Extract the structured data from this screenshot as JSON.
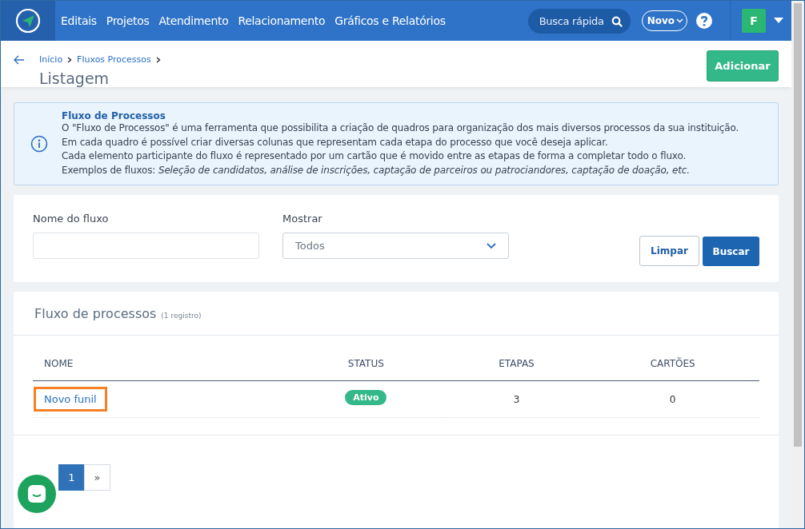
{
  "nav": {
    "items": [
      "Editais",
      "Projetos",
      "Atendimento",
      "Relacionamento",
      "Gráficos e Relatórios"
    ],
    "search": {
      "placeholder": "Busca rápida"
    },
    "new_button": "Novo",
    "avatar": "F"
  },
  "breadcrumb": [
    "Início",
    "Fluxos Processos"
  ],
  "page_title": "Listagem",
  "add_button": "Adicionar",
  "info": {
    "title": "Fluxo de Processos",
    "lines": [
      "O \"Fluxo de Processos\" é uma ferramenta que possibilita a criação de quadros para organização dos mais diversos processos da sua instituição.",
      "Em cada quadro é possível criar diversas colunas que representam cada etapa do processo que você deseja aplicar.",
      "Cada elemento participante do fluxo é representado por um cartão que é movido entre as etapas de forma a completar todo o fluxo.",
      "Exemplos de fluxos: *Seleção de candidatos, análise de inscrições, captação de parceiros ou patrociandores, captação de doação, etc.*"
    ]
  },
  "filters": {
    "name_label": "Nome do fluxo",
    "show_label": "Mostrar",
    "show_value": "Todos",
    "clear_button": "Limpar",
    "search_button": "Buscar"
  },
  "table": {
    "title": "Fluxo de processos",
    "count": "(1 registro)",
    "columns": [
      "NOME",
      "STATUS",
      "ETAPAS",
      "CARTÕES"
    ],
    "rows": [
      {
        "name": "Novo funil",
        "status": "Ativo",
        "active": true,
        "steps": "3",
        "cards": "0",
        "highlighted": true
      }
    ]
  },
  "pagination": [
    {
      "label": "1",
      "selected": true
    },
    {
      "label": "»",
      "selected": false
    }
  ]
}
